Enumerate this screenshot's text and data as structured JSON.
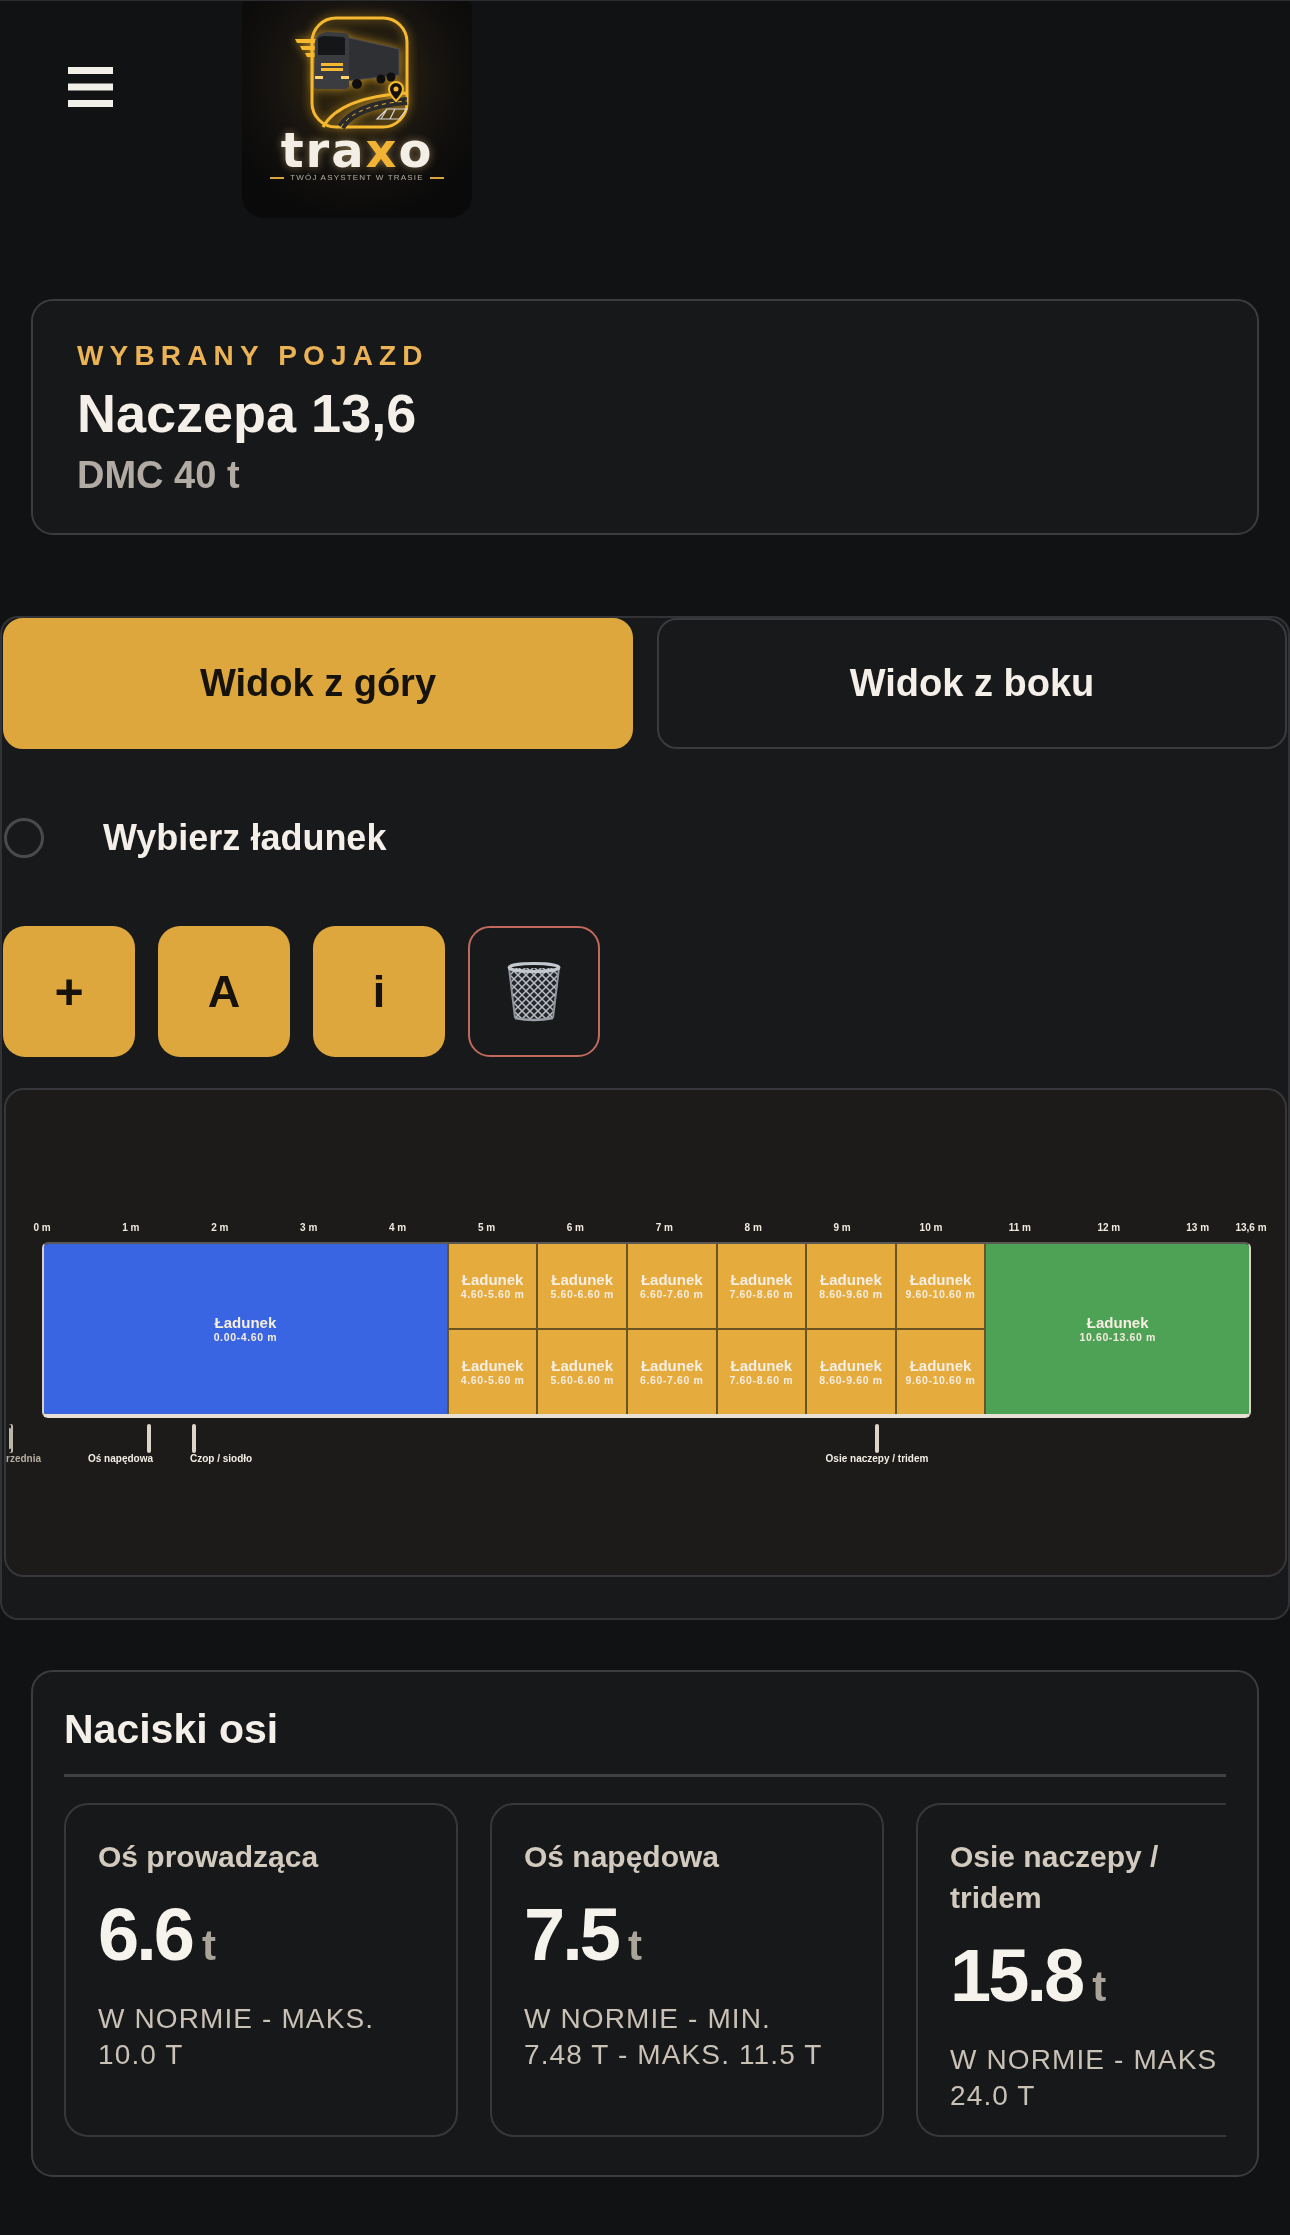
{
  "header": {
    "logo": {
      "wordmark": [
        {
          "text": "tra",
          "accent": false
        },
        {
          "text": "x",
          "accent": true
        },
        {
          "text": "o",
          "accent": false
        }
      ],
      "tagline": "TWÓJ ASYSTENT W TRASIE"
    }
  },
  "vehicle": {
    "label": "WYBRANY POJAZD",
    "name": "Naczepa 13,6",
    "weight": "DMC 40 t"
  },
  "tabs": [
    {
      "label": "Widok z góry",
      "selected": true
    },
    {
      "label": "Widok z boku",
      "selected": false
    }
  ],
  "load_select": {
    "label": "Wybierz ładunek",
    "selected": false
  },
  "tools": [
    {
      "kind": "add",
      "label": "+"
    },
    {
      "kind": "letter",
      "label": "A"
    },
    {
      "kind": "info",
      "label": "i"
    },
    {
      "kind": "delete"
    }
  ],
  "trailer": {
    "ruler": [
      "0 m",
      "1 m",
      "2 m",
      "3 m",
      "4 m",
      "5 m",
      "6 m",
      "7 m",
      "8 m",
      "9 m",
      "10 m",
      "11 m",
      "12 m",
      "13 m",
      "13,6 m"
    ],
    "loads": [
      {
        "kind": "block",
        "label": "Ładunek",
        "range": "0.00-4.60 m",
        "color": "#3964e2"
      },
      {
        "kind": "stack",
        "items": [
          {
            "label": "Ładunek",
            "range": "4.60-5.60 m",
            "color": "#e5ab3d"
          },
          {
            "label": "Ładunek",
            "range": "4.60-5.60 m",
            "color": "#e5ab3d"
          }
        ]
      },
      {
        "kind": "stack",
        "items": [
          {
            "label": "Ładunek",
            "range": "5.60-6.60 m",
            "color": "#e5ab3d"
          },
          {
            "label": "Ładunek",
            "range": "5.60-6.60 m",
            "color": "#e5ab3d"
          }
        ]
      },
      {
        "kind": "stack",
        "items": [
          {
            "label": "Ładunek",
            "range": "6.60-7.60 m",
            "color": "#e5ab3d"
          },
          {
            "label": "Ładunek",
            "range": "6.60-7.60 m",
            "color": "#e5ab3d"
          }
        ]
      },
      {
        "kind": "stack",
        "items": [
          {
            "label": "Ładunek",
            "range": "7.60-8.60 m",
            "color": "#e5ab3d"
          },
          {
            "label": "Ładunek",
            "range": "7.60-8.60 m",
            "color": "#e5ab3d"
          }
        ]
      },
      {
        "kind": "stack",
        "items": [
          {
            "label": "Ładunek",
            "range": "8.60-9.60 m",
            "color": "#e5ab3d"
          },
          {
            "label": "Ładunek",
            "range": "8.60-9.60 m",
            "color": "#e5ab3d"
          }
        ]
      },
      {
        "kind": "stack",
        "items": [
          {
            "label": "Ładunek",
            "range": "9.60-10.60 m",
            "color": "#e5ab3d"
          },
          {
            "label": "Ładunek",
            "range": "9.60-10.60 m",
            "color": "#e5ab3d"
          }
        ]
      },
      {
        "kind": "block",
        "label": "Ładunek",
        "range": "10.60-13.60 m",
        "color": "#4ea255"
      }
    ],
    "axles": [
      {
        "label": "rzednia",
        "dimmed": true
      },
      {
        "label": "Oś napędowa",
        "dimmed": false
      },
      {
        "label": "Czop / siodło",
        "dimmed": false
      },
      {
        "label": "Osie naczepy / tridem",
        "dimmed": false
      }
    ]
  },
  "axle_loads": {
    "title": "Naciski osi",
    "cards": [
      {
        "name": "Oś prowadząca",
        "value": "6.6",
        "unit": "t",
        "status": "W NORMIE - MAKS. 10.0 T"
      },
      {
        "name": "Oś napędowa",
        "value": "7.5",
        "unit": "t",
        "status": "W NORMIE - MIN.\n7.48 T - MAKS. 11.5 T"
      },
      {
        "name": "Osie naczepy / tridem",
        "value": "15.8",
        "unit": "t",
        "status": "W NORMIE - MAKS 24.0 T"
      }
    ]
  }
}
